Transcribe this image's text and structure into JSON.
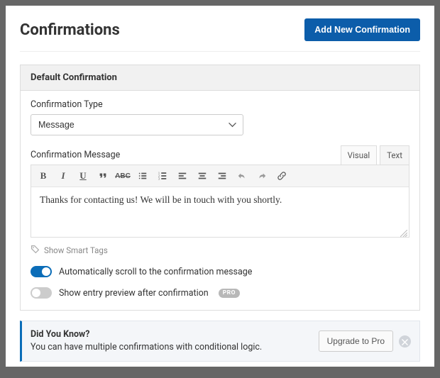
{
  "header": {
    "title": "Confirmations",
    "add_button": "Add New Confirmation"
  },
  "panel": {
    "title": "Default Confirmation",
    "type_label": "Confirmation Type",
    "type_value": "Message",
    "message_label": "Confirmation Message",
    "tabs": {
      "visual": "Visual",
      "text": "Text"
    },
    "editor_value": "Thanks for contacting us! We will be in touch with you shortly.",
    "smart_tags_label": "Show Smart Tags",
    "toggles": {
      "autoscroll": {
        "label": "Automatically scroll to the confirmation message",
        "on": true
      },
      "entry_preview": {
        "label": "Show entry preview after confirmation",
        "on": false,
        "badge": "PRO"
      }
    }
  },
  "callout": {
    "heading": "Did You Know?",
    "body": "You can have multiple confirmations with conditional logic.",
    "upgrade_button": "Upgrade to Pro"
  },
  "icons": {
    "chevron_down": "chevron-down-icon",
    "tag": "tag-icon",
    "close": "close-icon"
  }
}
